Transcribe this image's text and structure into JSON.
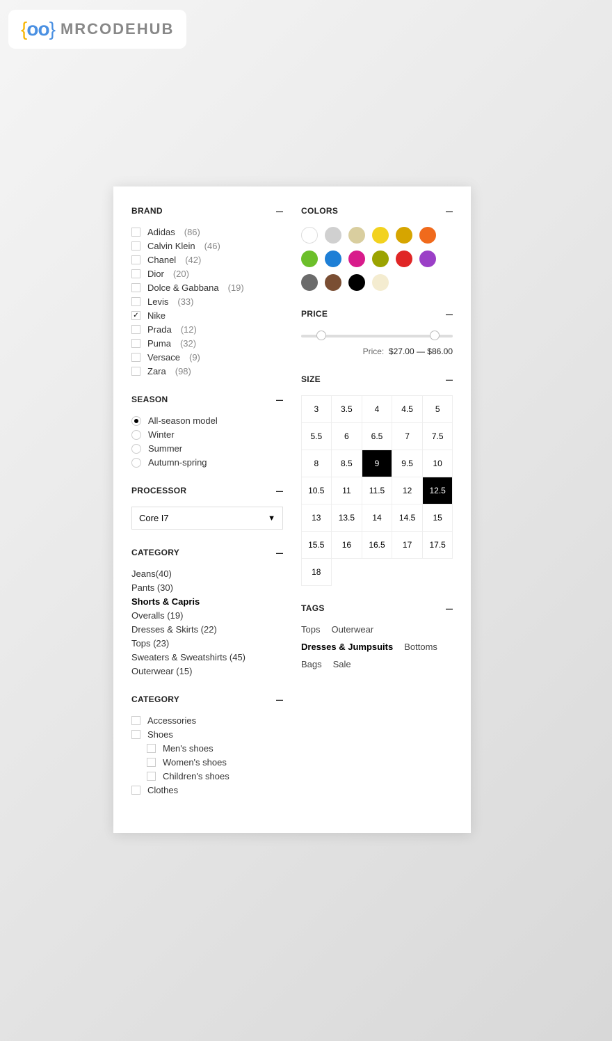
{
  "logo": {
    "text": "MRCODEHUB"
  },
  "brand": {
    "title": "BRAND",
    "items": [
      {
        "label": "Adidas",
        "count": "(86)",
        "checked": false
      },
      {
        "label": "Calvin Klein",
        "count": "(46)",
        "checked": false
      },
      {
        "label": "Chanel",
        "count": "(42)",
        "checked": false
      },
      {
        "label": "Dior",
        "count": "(20)",
        "checked": false
      },
      {
        "label": "Dolce & Gabbana",
        "count": "(19)",
        "checked": false
      },
      {
        "label": "Levis",
        "count": "(33)",
        "checked": false
      },
      {
        "label": "Nike",
        "count": "",
        "checked": true
      },
      {
        "label": "Prada",
        "count": "(12)",
        "checked": false
      },
      {
        "label": "Puma",
        "count": "(32)",
        "checked": false
      },
      {
        "label": "Versace",
        "count": "(9)",
        "checked": false
      },
      {
        "label": "Zara",
        "count": "(98)",
        "checked": false
      }
    ]
  },
  "season": {
    "title": "SEASON",
    "items": [
      {
        "label": "All-season model",
        "selected": true
      },
      {
        "label": "Winter",
        "selected": false
      },
      {
        "label": "Summer",
        "selected": false
      },
      {
        "label": "Autumn-spring",
        "selected": false
      }
    ]
  },
  "processor": {
    "title": "PROCESSOR",
    "selected": "Core I7"
  },
  "category": {
    "title": "CATEGORY",
    "items": [
      {
        "label": "Jeans",
        "count": "(40)",
        "active": false
      },
      {
        "label": "Pants",
        "count": " (30)",
        "active": false
      },
      {
        "label": "Shorts & Capris",
        "count": "",
        "active": true
      },
      {
        "label": "Overalls",
        "count": " (19)",
        "active": false
      },
      {
        "label": "Dresses & Skirts",
        "count": " (22)",
        "active": false
      },
      {
        "label": "Tops",
        "count": " (23)",
        "active": false
      },
      {
        "label": "Sweaters & Sweatshirts",
        "count": " (45)",
        "active": false
      },
      {
        "label": "Outerwear",
        "count": " (15)",
        "active": false
      }
    ]
  },
  "tree": {
    "title": "CATEGORY",
    "nodes": [
      {
        "label": "Accessories",
        "depth": 0
      },
      {
        "label": "Shoes",
        "depth": 0
      },
      {
        "label": "Men's shoes",
        "depth": 1
      },
      {
        "label": "Women's shoes",
        "depth": 1
      },
      {
        "label": "Children's shoes",
        "depth": 1
      },
      {
        "label": "Clothes",
        "depth": 0
      }
    ]
  },
  "colors": {
    "title": "COLORS",
    "swatches": [
      {
        "hex": "#ffffff",
        "border": true
      },
      {
        "hex": "#d0d0d0",
        "border": false
      },
      {
        "hex": "#d9ce9f",
        "border": false
      },
      {
        "hex": "#f2d21f",
        "border": false
      },
      {
        "hex": "#d6a500",
        "border": false
      },
      {
        "hex": "#f06a1c",
        "border": false
      },
      {
        "hex": "#6cbf2a",
        "border": false
      },
      {
        "hex": "#1e7fd6",
        "border": false
      },
      {
        "hex": "#d81b8b",
        "border": false
      },
      {
        "hex": "#9ba300",
        "border": false
      },
      {
        "hex": "#e02626",
        "border": false
      },
      {
        "hex": "#9b3fc7",
        "border": false
      },
      {
        "hex": "#6b6b6b",
        "border": false
      },
      {
        "hex": "#7a4e33",
        "border": false
      },
      {
        "hex": "#000000",
        "border": false
      },
      {
        "hex": "#f4ecd0",
        "border": false
      }
    ]
  },
  "price": {
    "title": "PRICE",
    "label": "Price:",
    "min_text": "$27.00",
    "sep": " — ",
    "max_text": "$86.00",
    "thumb1_pct": 10,
    "thumb2_pct": 85
  },
  "size": {
    "title": "SIZE",
    "cells": [
      {
        "v": "3"
      },
      {
        "v": "3.5"
      },
      {
        "v": "4"
      },
      {
        "v": "4.5"
      },
      {
        "v": "5"
      },
      {
        "v": "5.5"
      },
      {
        "v": "6"
      },
      {
        "v": "6.5"
      },
      {
        "v": "7"
      },
      {
        "v": "7.5"
      },
      {
        "v": "8"
      },
      {
        "v": "8.5"
      },
      {
        "v": "9",
        "active": true
      },
      {
        "v": "9.5"
      },
      {
        "v": "10"
      },
      {
        "v": "10.5"
      },
      {
        "v": "11"
      },
      {
        "v": "11.5"
      },
      {
        "v": "12"
      },
      {
        "v": "12.5",
        "active": true
      },
      {
        "v": "13"
      },
      {
        "v": "13.5"
      },
      {
        "v": "14"
      },
      {
        "v": "14.5"
      },
      {
        "v": "15"
      },
      {
        "v": "15.5"
      },
      {
        "v": "16"
      },
      {
        "v": "16.5"
      },
      {
        "v": "17"
      },
      {
        "v": "17.5"
      },
      {
        "v": "18"
      }
    ]
  },
  "tags": {
    "title": "TAGS",
    "items": [
      {
        "label": "Tops"
      },
      {
        "label": "Outerwear"
      },
      {
        "label": "Dresses & Jumpsuits",
        "active": true
      },
      {
        "label": "Bottoms"
      },
      {
        "label": "Bags"
      },
      {
        "label": "Sale"
      }
    ]
  }
}
